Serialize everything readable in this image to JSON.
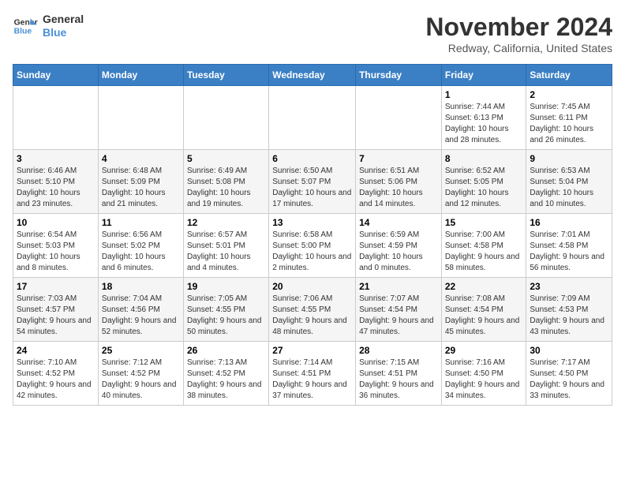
{
  "header": {
    "logo_line1": "General",
    "logo_line2": "Blue",
    "title": "November 2024",
    "location": "Redway, California, United States"
  },
  "weekdays": [
    "Sunday",
    "Monday",
    "Tuesday",
    "Wednesday",
    "Thursday",
    "Friday",
    "Saturday"
  ],
  "weeks": [
    [
      {
        "day": "",
        "info": ""
      },
      {
        "day": "",
        "info": ""
      },
      {
        "day": "",
        "info": ""
      },
      {
        "day": "",
        "info": ""
      },
      {
        "day": "",
        "info": ""
      },
      {
        "day": "1",
        "info": "Sunrise: 7:44 AM\nSunset: 6:13 PM\nDaylight: 10 hours and 28 minutes."
      },
      {
        "day": "2",
        "info": "Sunrise: 7:45 AM\nSunset: 6:11 PM\nDaylight: 10 hours and 26 minutes."
      }
    ],
    [
      {
        "day": "3",
        "info": "Sunrise: 6:46 AM\nSunset: 5:10 PM\nDaylight: 10 hours and 23 minutes."
      },
      {
        "day": "4",
        "info": "Sunrise: 6:48 AM\nSunset: 5:09 PM\nDaylight: 10 hours and 21 minutes."
      },
      {
        "day": "5",
        "info": "Sunrise: 6:49 AM\nSunset: 5:08 PM\nDaylight: 10 hours and 19 minutes."
      },
      {
        "day": "6",
        "info": "Sunrise: 6:50 AM\nSunset: 5:07 PM\nDaylight: 10 hours and 17 minutes."
      },
      {
        "day": "7",
        "info": "Sunrise: 6:51 AM\nSunset: 5:06 PM\nDaylight: 10 hours and 14 minutes."
      },
      {
        "day": "8",
        "info": "Sunrise: 6:52 AM\nSunset: 5:05 PM\nDaylight: 10 hours and 12 minutes."
      },
      {
        "day": "9",
        "info": "Sunrise: 6:53 AM\nSunset: 5:04 PM\nDaylight: 10 hours and 10 minutes."
      }
    ],
    [
      {
        "day": "10",
        "info": "Sunrise: 6:54 AM\nSunset: 5:03 PM\nDaylight: 10 hours and 8 minutes."
      },
      {
        "day": "11",
        "info": "Sunrise: 6:56 AM\nSunset: 5:02 PM\nDaylight: 10 hours and 6 minutes."
      },
      {
        "day": "12",
        "info": "Sunrise: 6:57 AM\nSunset: 5:01 PM\nDaylight: 10 hours and 4 minutes."
      },
      {
        "day": "13",
        "info": "Sunrise: 6:58 AM\nSunset: 5:00 PM\nDaylight: 10 hours and 2 minutes."
      },
      {
        "day": "14",
        "info": "Sunrise: 6:59 AM\nSunset: 4:59 PM\nDaylight: 10 hours and 0 minutes."
      },
      {
        "day": "15",
        "info": "Sunrise: 7:00 AM\nSunset: 4:58 PM\nDaylight: 9 hours and 58 minutes."
      },
      {
        "day": "16",
        "info": "Sunrise: 7:01 AM\nSunset: 4:58 PM\nDaylight: 9 hours and 56 minutes."
      }
    ],
    [
      {
        "day": "17",
        "info": "Sunrise: 7:03 AM\nSunset: 4:57 PM\nDaylight: 9 hours and 54 minutes."
      },
      {
        "day": "18",
        "info": "Sunrise: 7:04 AM\nSunset: 4:56 PM\nDaylight: 9 hours and 52 minutes."
      },
      {
        "day": "19",
        "info": "Sunrise: 7:05 AM\nSunset: 4:55 PM\nDaylight: 9 hours and 50 minutes."
      },
      {
        "day": "20",
        "info": "Sunrise: 7:06 AM\nSunset: 4:55 PM\nDaylight: 9 hours and 48 minutes."
      },
      {
        "day": "21",
        "info": "Sunrise: 7:07 AM\nSunset: 4:54 PM\nDaylight: 9 hours and 47 minutes."
      },
      {
        "day": "22",
        "info": "Sunrise: 7:08 AM\nSunset: 4:54 PM\nDaylight: 9 hours and 45 minutes."
      },
      {
        "day": "23",
        "info": "Sunrise: 7:09 AM\nSunset: 4:53 PM\nDaylight: 9 hours and 43 minutes."
      }
    ],
    [
      {
        "day": "24",
        "info": "Sunrise: 7:10 AM\nSunset: 4:52 PM\nDaylight: 9 hours and 42 minutes."
      },
      {
        "day": "25",
        "info": "Sunrise: 7:12 AM\nSunset: 4:52 PM\nDaylight: 9 hours and 40 minutes."
      },
      {
        "day": "26",
        "info": "Sunrise: 7:13 AM\nSunset: 4:52 PM\nDaylight: 9 hours and 38 minutes."
      },
      {
        "day": "27",
        "info": "Sunrise: 7:14 AM\nSunset: 4:51 PM\nDaylight: 9 hours and 37 minutes."
      },
      {
        "day": "28",
        "info": "Sunrise: 7:15 AM\nSunset: 4:51 PM\nDaylight: 9 hours and 36 minutes."
      },
      {
        "day": "29",
        "info": "Sunrise: 7:16 AM\nSunset: 4:50 PM\nDaylight: 9 hours and 34 minutes."
      },
      {
        "day": "30",
        "info": "Sunrise: 7:17 AM\nSunset: 4:50 PM\nDaylight: 9 hours and 33 minutes."
      }
    ]
  ]
}
